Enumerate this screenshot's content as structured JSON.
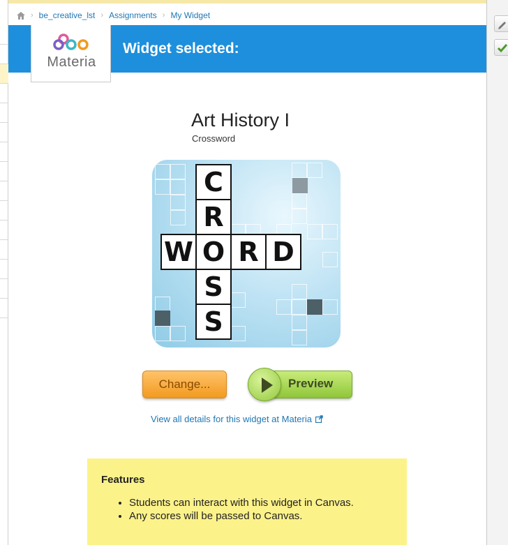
{
  "breadcrumb": {
    "items": [
      "be_creative_lst",
      "Assignments",
      "My Widget"
    ]
  },
  "header": {
    "title": "Widget selected:",
    "logo_text": "Materia"
  },
  "widget": {
    "title": "Art History I",
    "type": "Crossword",
    "thumbnail_letters": {
      "vertical": [
        "C",
        "R",
        "O",
        "S",
        "S"
      ],
      "horizontal": [
        "W",
        "O",
        "R",
        "D"
      ]
    }
  },
  "actions": {
    "change_label": "Change...",
    "preview_label": "Preview",
    "details_link": "View all details for this widget at Materia"
  },
  "features": {
    "title": "Features",
    "items": [
      "Students can interact with this widget in Canvas.",
      "Any scores will be passed to Canvas."
    ]
  },
  "colors": {
    "header_blue": "#1e8fdc",
    "change_orange": "#f29a1f",
    "preview_green": "#90c63a",
    "features_yellow": "#fcf28a",
    "link_blue": "#1f77b4"
  },
  "icons": {
    "home": "home-icon",
    "external": "external-link-icon",
    "pencil": "pencil-icon",
    "check": "check-icon",
    "play": "play-icon"
  }
}
